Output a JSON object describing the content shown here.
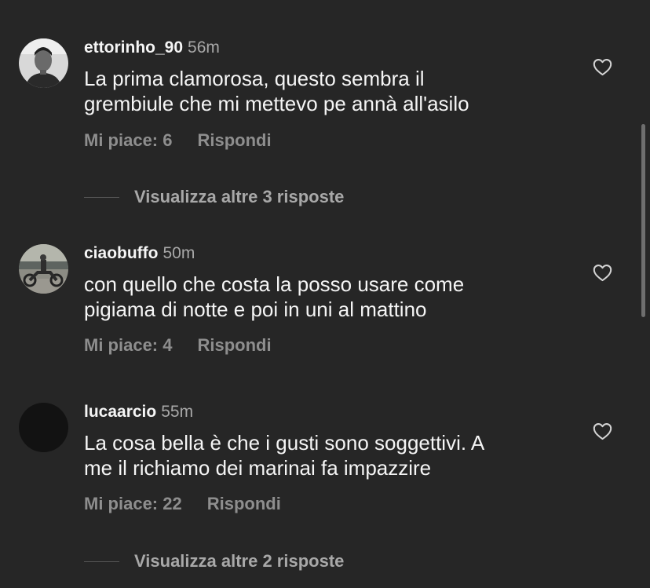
{
  "colors": {
    "background": "#262626",
    "text_primary": "#f5f5f5",
    "text_secondary": "#a8a8a8",
    "text_actions": "#8e8e8e"
  },
  "comments": [
    {
      "username": "ettorinho_90",
      "time": "56m",
      "text_lines": [
        "La prima clamorosa, questo sembra il",
        "grembiule che mi mettevo pe annà all'asilo"
      ],
      "likes_label": "Mi piace: 6",
      "reply_label": "Rispondi",
      "like_icon": "heart-outline-icon",
      "view_replies": "Visualizza altre 3 risposte"
    },
    {
      "username": "ciaobuffo",
      "time": "50m",
      "text_lines": [
        "con quello che costa la posso usare come",
        "pigiama di notte e poi in uni al mattino"
      ],
      "likes_label": "Mi piace: 4",
      "reply_label": "Rispondi",
      "like_icon": "heart-outline-icon"
    },
    {
      "username": "lucaarcio",
      "time": "55m",
      "text_lines": [
        "La cosa bella è che i gusti sono soggettivi. A",
        "me il richiamo dei marinai fa impazzire"
      ],
      "likes_label": "Mi piace: 22",
      "reply_label": "Rispondi",
      "like_icon": "heart-outline-icon",
      "view_replies": "Visualizza altre 2 risposte"
    }
  ]
}
